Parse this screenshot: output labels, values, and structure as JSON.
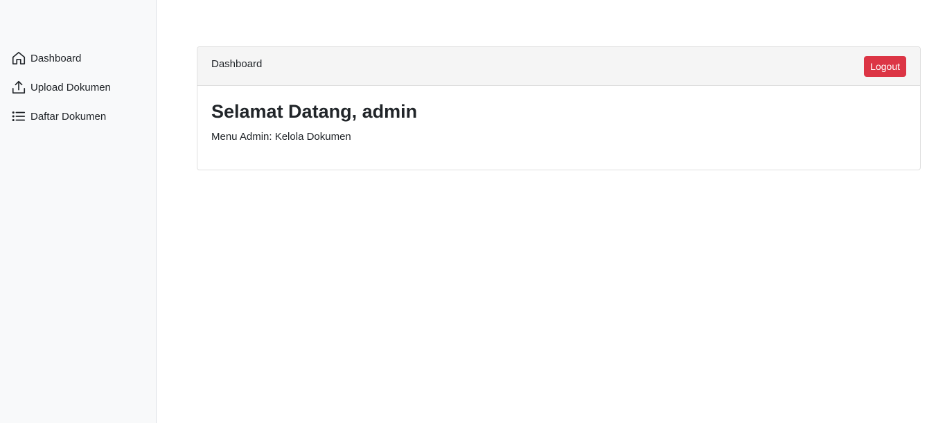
{
  "sidebar": {
    "items": [
      {
        "label": "Dashboard",
        "icon": "house-icon"
      },
      {
        "label": "Upload Dokumen",
        "icon": "upload-icon"
      },
      {
        "label": "Daftar Dokumen",
        "icon": "list-icon"
      }
    ]
  },
  "card": {
    "header_title": "Dashboard",
    "logout_label": "Logout",
    "welcome": "Selamat Datang, admin",
    "menu_text": "Menu Admin: Kelola Dokumen"
  },
  "colors": {
    "danger": "#dc3545",
    "sidebar_bg": "#f8f9fa",
    "header_bg": "#f5f5f5"
  }
}
